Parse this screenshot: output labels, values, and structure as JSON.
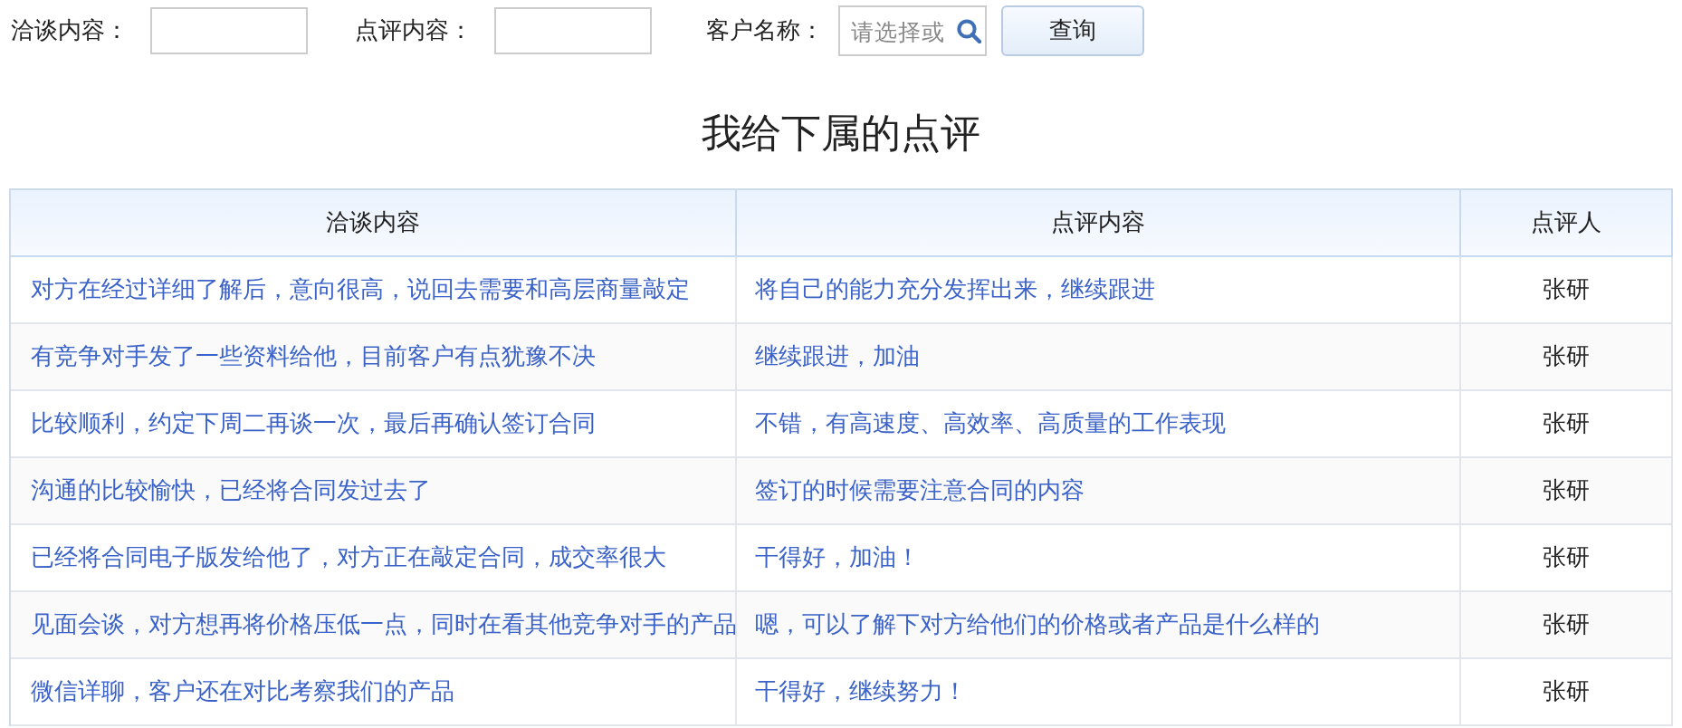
{
  "filters": [
    {
      "label": "洽谈内容："
    },
    {
      "label": "点评内容："
    },
    {
      "label": "客户名称：",
      "placeholder": "请选择或"
    }
  ],
  "query_button": "查询",
  "title": "我给下属的点评",
  "table": {
    "columns": [
      "洽谈内容",
      "点评内容",
      "点评人"
    ],
    "rows": [
      [
        "对方在经过详细了解后，意向很高，说回去需要和高层商量敲定",
        "将自己的能力充分发挥出来，继续跟进",
        "张研"
      ],
      [
        "有竞争对手发了一些资料给他，目前客户有点犹豫不决",
        "继续跟进，加油",
        "张研"
      ],
      [
        "比较顺利，约定下周二再谈一次，最后再确认签订合同",
        "不错，有高速度、高效率、高质量的工作表现",
        "张研"
      ],
      [
        "沟通的比较愉快，已经将合同发过去了",
        "签订的时候需要注意合同的内容",
        "张研"
      ],
      [
        "已经将合同电子版发给他了，对方正在敲定合同，成交率很大",
        "干得好，加油！",
        "张研"
      ],
      [
        "见面会谈，对方想再将价格压低一点，同时在看其他竞争对手的产品",
        "嗯，可以了解下对方给他们的价格或者产品是什么样的",
        "张研"
      ],
      [
        "微信详聊，客户还在对比考察我们的产品",
        "干得好，继续努力！",
        "张研"
      ]
    ]
  }
}
